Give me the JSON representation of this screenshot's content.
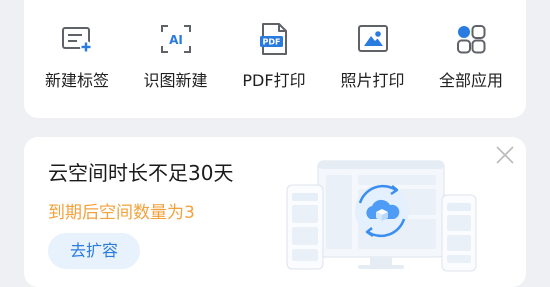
{
  "quick_actions": [
    {
      "label": "新建标签",
      "icon": "new-label-icon"
    },
    {
      "label": "识图新建",
      "icon": "ai-recognize-icon"
    },
    {
      "label": "PDF打印",
      "icon": "pdf-icon"
    },
    {
      "label": "照片打印",
      "icon": "photo-icon"
    },
    {
      "label": "全部应用",
      "icon": "apps-grid-icon"
    }
  ],
  "promo": {
    "title": "云空间时长不足30天",
    "subtitle": "到期后空间数量为3",
    "button_label": "去扩容",
    "ai_badge": "AI",
    "pdf_badge": "PDF"
  },
  "colors": {
    "accent": "#2a7be0",
    "warning": "#f2a23c",
    "icon_gray": "#5f6368"
  }
}
